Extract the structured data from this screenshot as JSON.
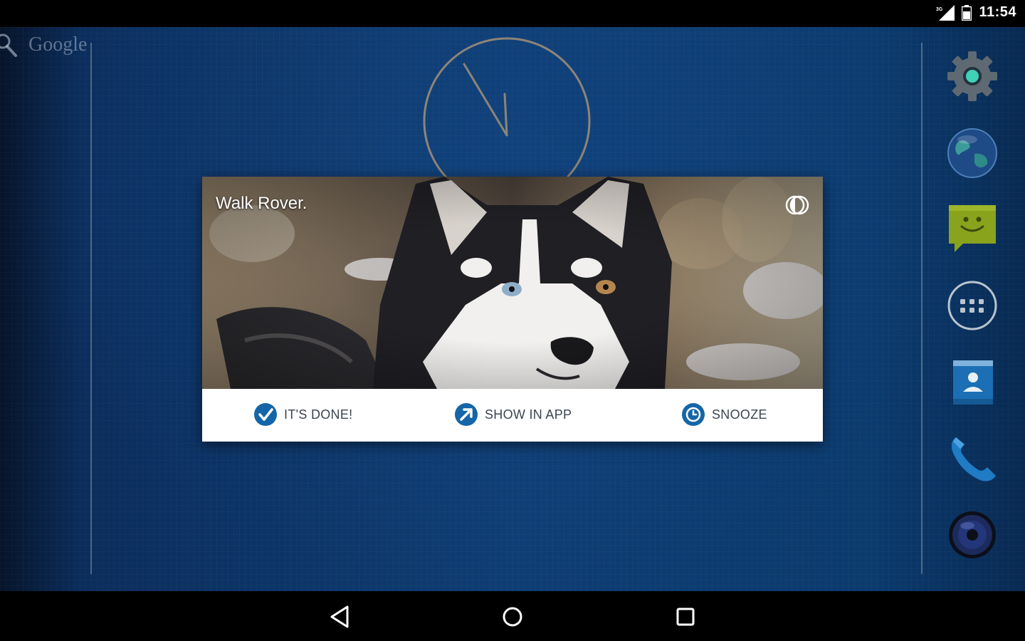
{
  "status_bar": {
    "time": "11:54",
    "network_label": "3G",
    "icons": [
      "signal-icon",
      "battery-icon"
    ]
  },
  "home": {
    "search_label": "Google",
    "dock": [
      {
        "name": "settings",
        "icon": "gear-icon"
      },
      {
        "name": "browser",
        "icon": "globe-icon"
      },
      {
        "name": "messaging",
        "icon": "message-icon"
      },
      {
        "name": "apps",
        "icon": "apps-grid-icon"
      },
      {
        "name": "contacts",
        "icon": "contacts-icon"
      },
      {
        "name": "phone",
        "icon": "phone-icon"
      },
      {
        "name": "music",
        "icon": "speaker-icon"
      }
    ]
  },
  "notification": {
    "title": "Walk Rover.",
    "image": "husky-dog-photo",
    "actions": [
      {
        "label": "IT'S DONE!",
        "icon": "check-circle-icon"
      },
      {
        "label": "SHOW IN APP",
        "icon": "open-app-icon"
      },
      {
        "label": "SNOOZE",
        "icon": "clock-icon"
      }
    ],
    "accent_color": "#1566a8"
  },
  "nav_bar": {
    "buttons": [
      "back-icon",
      "home-icon",
      "recents-icon"
    ]
  }
}
